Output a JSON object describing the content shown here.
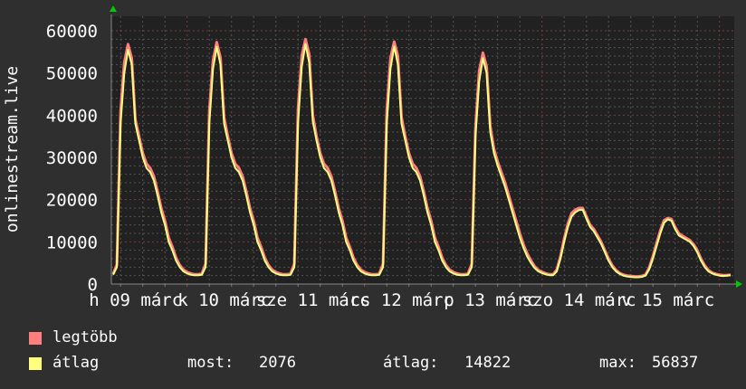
{
  "chart_data": {
    "type": "area",
    "ylabel": "onlinestream.live",
    "ylim": [
      0,
      60000
    ],
    "y_ticks": [
      "0",
      "10000",
      "20000",
      "30000",
      "40000",
      "50000",
      "60000"
    ],
    "x_tick_labels": [
      "h 09 márc",
      "k 10 márc",
      "sze 11 márc",
      "cs 12 márc",
      "p 13 márc",
      "szo 14 márc",
      "v 15 márc"
    ],
    "x_start": "09 márc 04:00",
    "x_step": "1 óra",
    "grid": true,
    "legend_position": "bottom",
    "series": [
      {
        "name": "legtöbb",
        "color": "#ff7f7f",
        "values": [
          2400,
          4600,
          41000,
          52500,
          56800,
          53500,
          39000,
          35000,
          31000,
          28500,
          27500,
          25500,
          22000,
          18000,
          15000,
          11000,
          8800,
          6200,
          4500,
          3400,
          2800,
          2500,
          2300,
          2300,
          2500,
          4800,
          41000,
          53000,
          57300,
          53600,
          39500,
          35000,
          31000,
          28500,
          27500,
          25500,
          22000,
          18000,
          15000,
          11000,
          8800,
          6200,
          4500,
          3400,
          2800,
          2500,
          2300,
          2300,
          2500,
          4800,
          41500,
          54000,
          58000,
          54500,
          40000,
          35000,
          31000,
          28500,
          27500,
          25500,
          22000,
          18000,
          15000,
          11000,
          8800,
          6200,
          4500,
          3400,
          2800,
          2500,
          2300,
          2300,
          2500,
          4800,
          41000,
          53500,
          57400,
          54000,
          39500,
          35000,
          31000,
          28500,
          27500,
          25500,
          22000,
          18000,
          15000,
          11000,
          8800,
          6200,
          4500,
          3400,
          2800,
          2500,
          2300,
          2300,
          2500,
          4800,
          37000,
          50500,
          54800,
          51500,
          37500,
          32000,
          29000,
          26500,
          24000,
          21000,
          18000,
          15000,
          12000,
          9300,
          7200,
          5600,
          4200,
          3300,
          2900,
          2500,
          2300,
          2300,
          3400,
          6600,
          10800,
          14300,
          16800,
          17600,
          18000,
          18000,
          16000,
          14000,
          13000,
          11500,
          10000,
          8000,
          6000,
          4400,
          3300,
          2600,
          2200,
          2000,
          1900,
          1800,
          1800,
          1900,
          2200,
          3900,
          6600,
          9700,
          12700,
          15100,
          15600,
          15400,
          13500,
          12000,
          11400,
          10900,
          10400,
          9400,
          8000,
          6000,
          4400,
          3300,
          2700,
          2400,
          2200,
          2100,
          2100,
          2200
        ]
      },
      {
        "name": "átlag",
        "color": "#ffff7f",
        "values": [
          2200,
          4000,
          38000,
          50000,
          55500,
          52000,
          38000,
          34000,
          30000,
          27500,
          26500,
          24500,
          21000,
          17000,
          14000,
          10000,
          8000,
          5500,
          4000,
          3000,
          2500,
          2200,
          2100,
          2100,
          2200,
          4000,
          38000,
          51000,
          56200,
          52000,
          38000,
          34000,
          30000,
          27500,
          26500,
          24500,
          21000,
          17000,
          14000,
          10000,
          8000,
          5500,
          4000,
          3000,
          2500,
          2200,
          2100,
          2100,
          2200,
          4000,
          38000,
          51500,
          56837,
          52500,
          38500,
          34000,
          30000,
          27500,
          26500,
          24500,
          21000,
          17000,
          14000,
          10000,
          8000,
          5500,
          4000,
          3000,
          2500,
          2200,
          2100,
          2100,
          2200,
          4000,
          38000,
          51000,
          56300,
          52000,
          38000,
          34000,
          30000,
          27500,
          26500,
          24500,
          21000,
          17000,
          14000,
          10000,
          8000,
          5500,
          4000,
          3000,
          2500,
          2200,
          2100,
          2100,
          2200,
          4000,
          35000,
          48000,
          53500,
          50000,
          36000,
          31000,
          28000,
          25500,
          23000,
          20000,
          17000,
          14000,
          11000,
          8500,
          6500,
          5000,
          3800,
          3000,
          2600,
          2300,
          2100,
          2100,
          3000,
          6000,
          10000,
          13500,
          16000,
          17000,
          17500,
          17600,
          15500,
          13500,
          12500,
          11000,
          9500,
          7500,
          5500,
          4000,
          3000,
          2400,
          2000,
          1800,
          1700,
          1600,
          1600,
          1700,
          2000,
          3500,
          6000,
          9000,
          12000,
          14500,
          15300,
          15000,
          13000,
          11500,
          11000,
          10500,
          10000,
          9000,
          7500,
          5500,
          4000,
          3000,
          2500,
          2200,
          2000,
          1900,
          2000,
          2076
        ]
      }
    ],
    "stats": {
      "most_label": "most:",
      "most": "2076",
      "atlag_label": "átlag:",
      "atlag": "14822",
      "max_label": "max:",
      "max": "56837"
    }
  }
}
